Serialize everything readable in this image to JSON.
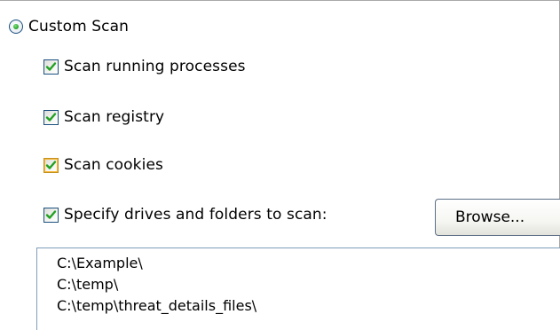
{
  "scan_mode": {
    "option_label": "Custom Scan",
    "selected": true
  },
  "options": [
    {
      "label": "Scan running processes",
      "checked": true
    },
    {
      "label": "Scan registry",
      "checked": true
    },
    {
      "label": "Scan cookies",
      "checked": true
    },
    {
      "label": "Specify drives and folders to scan:",
      "checked": true
    }
  ],
  "browse_button": {
    "label": "Browse..."
  },
  "paths": [
    "C:\\Example\\",
    "C:\\temp\\",
    "C:\\temp\\threat_details_files\\"
  ],
  "colors": {
    "check_mark": "#21a121",
    "checkbox_border": "#1c5180",
    "hover_border": "#f8b636",
    "list_border": "#7f9db9"
  },
  "icons": {
    "radio": "radio-selected-icon",
    "checkbox": "checkbox-checked-icon"
  }
}
